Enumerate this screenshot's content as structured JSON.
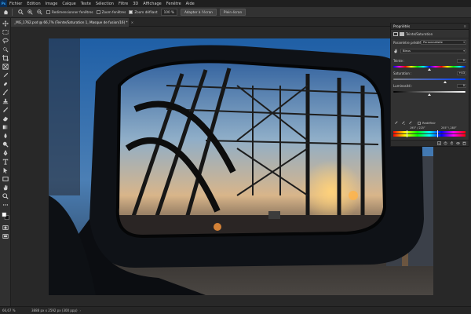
{
  "menu": {
    "items": [
      "Fichier",
      "Edition",
      "Image",
      "Calque",
      "Texte",
      "Sélection",
      "Filtre",
      "3D",
      "Affichage",
      "Fenêtre",
      "Aide"
    ]
  },
  "options": {
    "resize_windows_label": "Redimensionner fenêtres",
    "zoom_all_label": "Zoom fenêtres",
    "scrubby_zoom_label": "Zoom défilant",
    "zoom_value": "100 %",
    "fit_screen_label": "Adapter à l'écran",
    "fill_screen_label": "Plein écran"
  },
  "document": {
    "tab_title": "_MG_1762.psd @ 66,7% (Teinte/Saturation 1, Masque de fusion/16) *"
  },
  "properties": {
    "panel_title": "Propriétés",
    "adjustment_name": "Teinte/Saturation",
    "preset_label": "Paramètre prédéfini :",
    "preset_value": "Personnalisée",
    "channel_value": "Bleus",
    "hue_label": "Teinte :",
    "hue_value": "0",
    "saturation_label": "Saturation :",
    "saturation_value": "+43",
    "saturation_level": 0.72,
    "lightness_label": "Luminosité :",
    "lightness_value": "0",
    "colorize_label": "Redéfinir",
    "range_left": "195° / 225°",
    "range_right": "255° \\ 285°"
  },
  "status": {
    "zoom": "66,67 %",
    "doc_info": "3888 px x 2592 px (300 ppp)"
  },
  "colors": {
    "accent": "#31a8ff",
    "panel_bg": "#323232",
    "app_bg": "#282828"
  },
  "icons": [
    "home-icon",
    "zoom-in-icon",
    "zoom-out-icon",
    "adjustment-layer-icon",
    "mask-icon",
    "eyedropper-icon",
    "clip-icon",
    "visibility-icon",
    "reset-icon",
    "trash-icon"
  ]
}
